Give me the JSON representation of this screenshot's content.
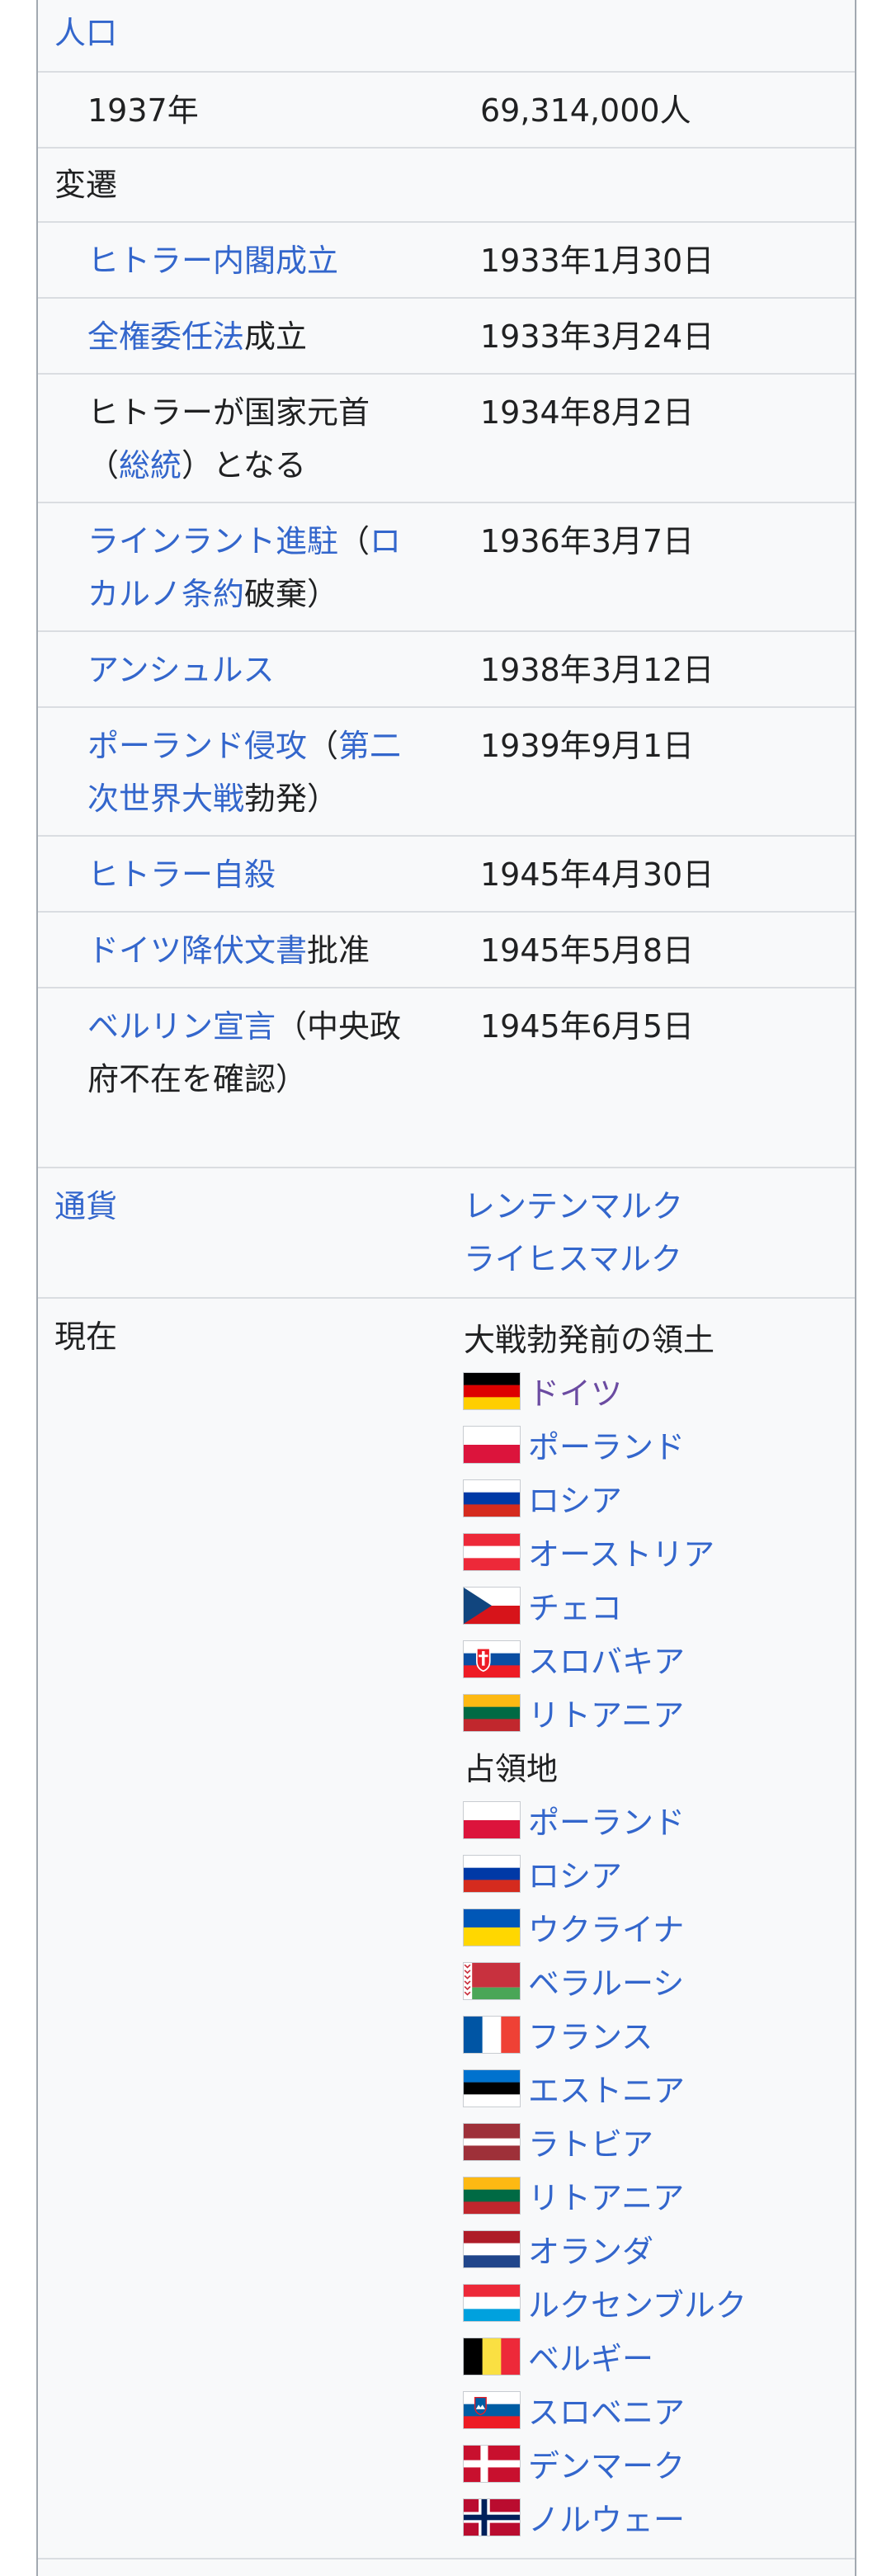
{
  "population": {
    "header": "人口",
    "year": "1937年",
    "value": "69,314,000人"
  },
  "history": {
    "header": "変遷",
    "events": [
      {
        "parts": [
          {
            "text": "ヒトラー内閣成立",
            "link": true
          }
        ],
        "date": "1933年1月30日"
      },
      {
        "parts": [
          {
            "text": "全権委任法",
            "link": true
          },
          {
            "text": "成立",
            "link": false
          }
        ],
        "date": "1933年3月24日"
      },
      {
        "parts": [
          {
            "text": "ヒトラーが国家元首（",
            "link": false
          },
          {
            "text": "総統",
            "link": true
          },
          {
            "text": "）となる",
            "link": false
          }
        ],
        "date": "1934年8月2日"
      },
      {
        "parts": [
          {
            "text": "ラインラント進駐",
            "link": true
          },
          {
            "text": "（",
            "link": false
          },
          {
            "text": "ロカルノ条約",
            "link": true
          },
          {
            "text": "破棄）",
            "link": false
          }
        ],
        "date": "1936年3月7日"
      },
      {
        "parts": [
          {
            "text": "アンシュルス",
            "link": true
          }
        ],
        "date": "1938年3月12日"
      },
      {
        "parts": [
          {
            "text": "ポーランド侵攻",
            "link": true
          },
          {
            "text": "（",
            "link": false
          },
          {
            "text": "第二次世界大戦",
            "link": true
          },
          {
            "text": "勃発）",
            "link": false
          }
        ],
        "date": "1939年9月1日"
      },
      {
        "parts": [
          {
            "text": "ヒトラー自殺",
            "link": true
          }
        ],
        "date": "1945年4月30日"
      },
      {
        "parts": [
          {
            "text": "ドイツ降伏文書",
            "link": true
          },
          {
            "text": "批准",
            "link": false
          }
        ],
        "date": "1945年5月8日"
      },
      {
        "parts": [
          {
            "text": "ベルリン宣言",
            "link": true
          },
          {
            "text": "（中央政府不在を確認）",
            "link": false
          }
        ],
        "date": "1945年6月5日"
      }
    ]
  },
  "currency": {
    "label": "通貨",
    "values": [
      "レンテンマルク",
      "ライヒスマルク"
    ]
  },
  "present": {
    "label": "現在",
    "prewar_header": "大戦勃発前の領土",
    "prewar": [
      {
        "name": "ドイツ",
        "flag": "germany",
        "color": "#6b4ba1"
      },
      {
        "name": "ポーランド",
        "flag": "poland",
        "color": "#3366cc"
      },
      {
        "name": "ロシア",
        "flag": "russia",
        "color": "#3366cc"
      },
      {
        "name": "オーストリア",
        "flag": "austria",
        "color": "#3366cc"
      },
      {
        "name": "チェコ",
        "flag": "czech",
        "color": "#3366cc"
      },
      {
        "name": "スロバキア",
        "flag": "slovakia",
        "color": "#3366cc"
      },
      {
        "name": "リトアニア",
        "flag": "lithuania",
        "color": "#3366cc"
      }
    ],
    "occupied_header": "占領地",
    "occupied": [
      {
        "name": "ポーランド",
        "flag": "poland",
        "color": "#3366cc"
      },
      {
        "name": "ロシア",
        "flag": "russia",
        "color": "#3366cc"
      },
      {
        "name": "ウクライナ",
        "flag": "ukraine",
        "color": "#3366cc"
      },
      {
        "name": "ベラルーシ",
        "flag": "belarus",
        "color": "#3366cc"
      },
      {
        "name": "フランス",
        "flag": "france",
        "color": "#3366cc"
      },
      {
        "name": "エストニア",
        "flag": "estonia",
        "color": "#3366cc"
      },
      {
        "name": "ラトビア",
        "flag": "latvia",
        "color": "#3366cc"
      },
      {
        "name": "リトアニア",
        "flag": "lithuania",
        "color": "#3366cc"
      },
      {
        "name": "オランダ",
        "flag": "netherlands",
        "color": "#3366cc"
      },
      {
        "name": "ルクセンブルク",
        "flag": "luxembourg",
        "color": "#3366cc"
      },
      {
        "name": "ベルギー",
        "flag": "belgium",
        "color": "#3366cc"
      },
      {
        "name": "スロベニア",
        "flag": "slovenia",
        "color": "#3366cc"
      },
      {
        "name": "デンマーク",
        "flag": "denmark",
        "color": "#3366cc"
      },
      {
        "name": "ノルウェー",
        "flag": "norway",
        "color": "#3366cc"
      }
    ]
  }
}
